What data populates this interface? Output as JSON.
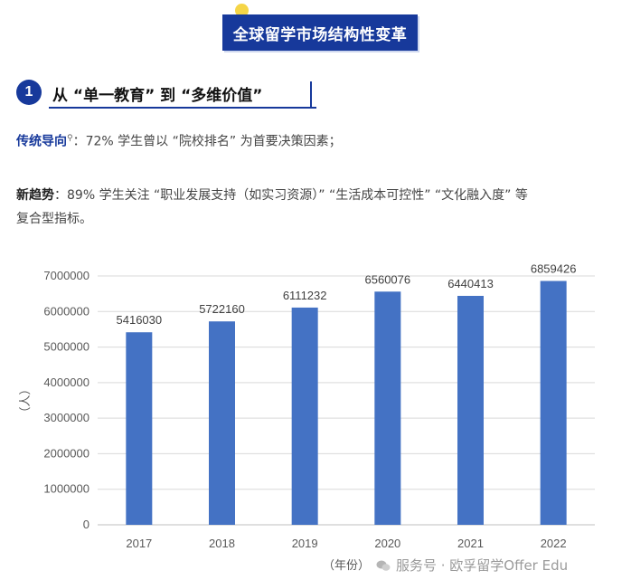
{
  "header": {
    "title": "全球留学市场结构性变革"
  },
  "section": {
    "number": "1",
    "title": "从 “单一教育” 到 “多维价值”"
  },
  "traditional": {
    "label": "传统导向",
    "text": "：72% 学生曾以 “院校排名” 为首要决策因素；"
  },
  "new_trend": {
    "label": "新趋势",
    "text": "：89% 学生关注 “职业发展支持（如实习资源）” “生活成本可控性” “文化融入度” 等",
    "text_line2": "复合型指标。"
  },
  "chart_data": {
    "type": "bar",
    "categories": [
      "2017",
      "2018",
      "2019",
      "2020",
      "2021",
      "2022"
    ],
    "values": [
      5416030,
      5722160,
      6111232,
      6560076,
      6440413,
      6859426
    ],
    "ylabel": "（人）",
    "xlabel": "（年份）",
    "ylim": [
      0,
      7000000
    ],
    "yticks": [
      0,
      1000000,
      2000000,
      3000000,
      4000000,
      5000000,
      6000000,
      7000000
    ],
    "grid": true,
    "bar_color": "#4472c4"
  },
  "watermark": {
    "text": "服务号 · 欧孚留学Offer Edu"
  }
}
